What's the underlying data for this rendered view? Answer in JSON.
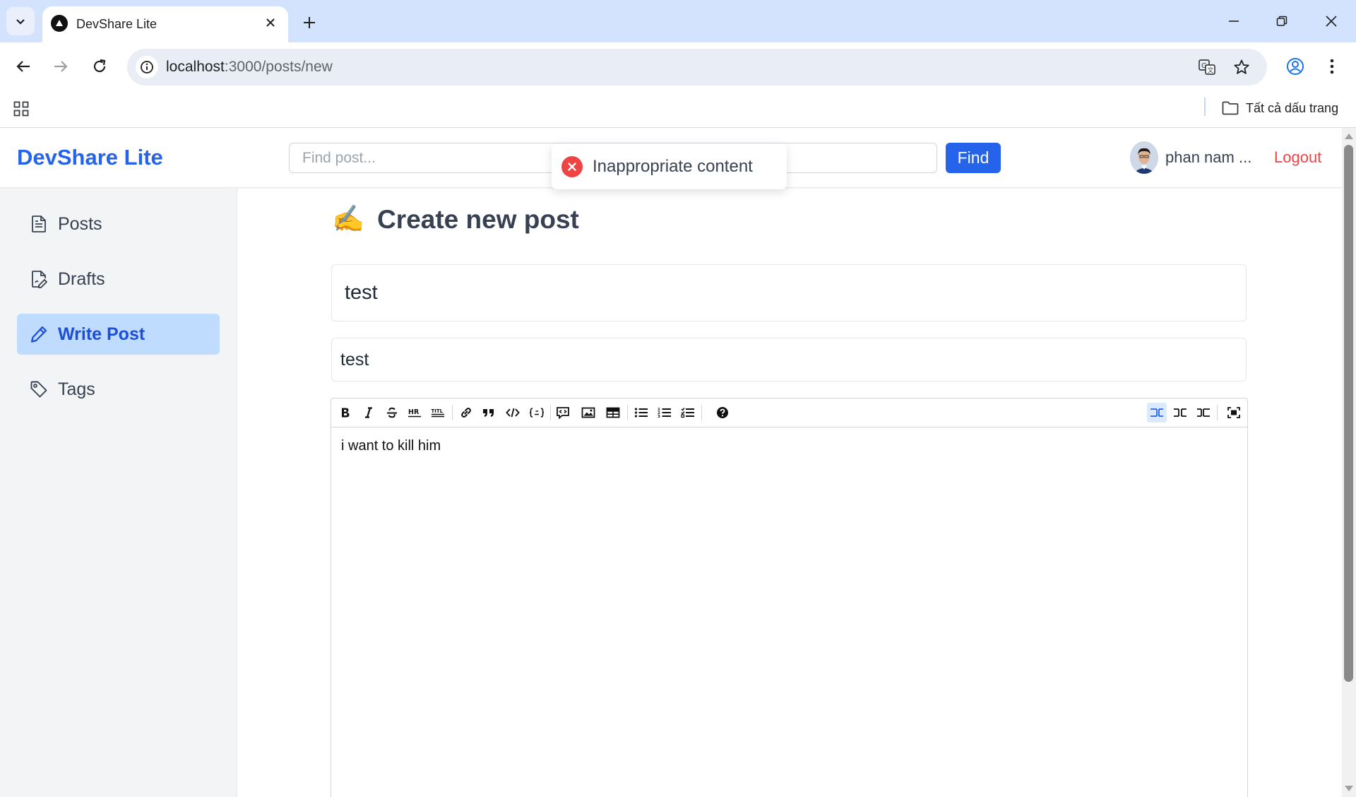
{
  "browser": {
    "tab_title": "DevShare Lite",
    "url_host": "localhost",
    "url_path": ":3000/posts/new",
    "bookmarks_all_label": "Tất cả dấu trang"
  },
  "header": {
    "brand": "DevShare Lite",
    "search_placeholder": "Find post...",
    "search_button": "Find",
    "username": "phan nam ...",
    "logout_label": "Logout"
  },
  "sidebar": {
    "items": [
      {
        "label": "Posts",
        "icon": "document-icon",
        "active": false
      },
      {
        "label": "Drafts",
        "icon": "draft-icon",
        "active": false
      },
      {
        "label": "Write Post",
        "icon": "pencil-icon",
        "active": true
      },
      {
        "label": "Tags",
        "icon": "tag-icon",
        "active": false
      }
    ]
  },
  "main": {
    "title_emoji": "✍️",
    "title": "Create new post",
    "post_title_value": "test",
    "post_description_value": "test",
    "editor_content": "i want to kill him",
    "editor_toolbar": [
      "bold",
      "italic",
      "strikethrough",
      "hr",
      "title",
      "link",
      "quote",
      "code",
      "code-block",
      "comment",
      "image",
      "table",
      "unordered-list",
      "ordered-list",
      "task-list",
      "help",
      "edit-mode",
      "live-mode",
      "preview-mode",
      "fullscreen"
    ]
  },
  "toast": {
    "message": "Inappropriate content",
    "type": "error"
  },
  "colors": {
    "brand": "#2563eb",
    "active_bg": "#bfdbfe",
    "logout": "#ef4444",
    "error": "#ef4444"
  }
}
